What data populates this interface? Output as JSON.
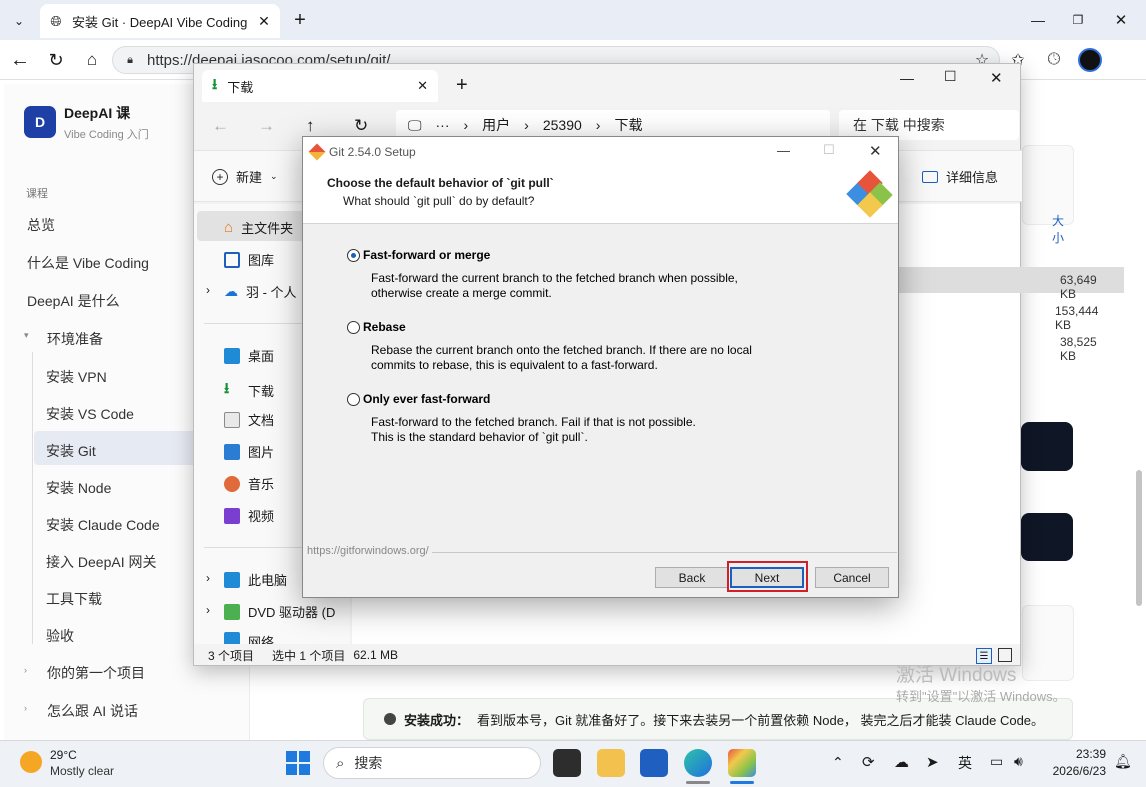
{
  "browser": {
    "tab_title": "安装 Git · DeepAI Vibe Coding 课",
    "url": "https://deepai.iasocoo.com/setup/git/"
  },
  "site": {
    "logo_letter": "D",
    "name": "DeepAI 课",
    "subtitle": "Vibe Coding 入门",
    "section_label": "课程",
    "nav": [
      "总览",
      "什么是 Vibe Coding",
      "DeepAI 是什么"
    ],
    "env_group": "环境准备",
    "env_items": [
      "安装 VPN",
      "安装 VS Code",
      "安装 Git",
      "安装 Node",
      "安装 Claude Code",
      "接入 DeepAI 网关",
      "工具下载",
      "验收"
    ],
    "nav_bottom": [
      "你的第一个项目",
      "怎么跟 AI 说话"
    ],
    "notice_label": "安装成功：",
    "notice_text": "看到版本号，Git 就准备好了。接下来去装另一个前置依赖 Node， 装完之后才能装 Claude Code。"
  },
  "explorer": {
    "tab_title": "下载",
    "path": [
      "用户",
      "25390",
      "下载"
    ],
    "search_placeholder": "在 下载 中搜索",
    "new_label": "新建",
    "details_label": "详细信息",
    "size_col": "大小",
    "sizes": [
      "63,649 KB",
      "153,444 KB",
      "38,525 KB"
    ],
    "nav_items": [
      "主文件夹",
      "图库",
      "羽 - 个人"
    ],
    "quick_items": [
      "桌面",
      "下载",
      "文档",
      "图片",
      "音乐",
      "视频"
    ],
    "drive_items": [
      "此电脑",
      "DVD 驱动器 (D",
      "网络"
    ],
    "status_count": "3 个项目",
    "status_selected": "选中 1 个项目",
    "status_size": "62.1 MB"
  },
  "dialog": {
    "title": "Git 2.54.0 Setup",
    "heading": "Choose the default behavior of `git pull`",
    "subheading": "What should `git pull` do by default?",
    "options": [
      {
        "label": "Fast-forward or merge",
        "desc1": "Fast-forward the current branch to the fetched branch when possible,",
        "desc2": "otherwise create a merge commit.",
        "selected": true
      },
      {
        "label": "Rebase",
        "desc1": "Rebase the current branch onto the fetched branch. If there are no local",
        "desc2": "commits to rebase, this is equivalent to a fast-forward.",
        "selected": false
      },
      {
        "label": "Only ever fast-forward",
        "desc1": "Fast-forward to the fetched branch. Fail if that is not possible.",
        "desc2": "This is the standard behavior of `git pull`.",
        "selected": false
      }
    ],
    "footer_link": "https://gitforwindows.org/",
    "back": "Back",
    "next": "Next",
    "cancel": "Cancel"
  },
  "watermark": {
    "line1": "激活 Windows",
    "line2": "转到\"设置\"以激活 Windows。"
  },
  "taskbar": {
    "weather_temp": "29°C",
    "weather_text": "Mostly clear",
    "search": "搜索",
    "ime": "英",
    "time": "23:39",
    "date": "2026/6/23"
  },
  "colors": {
    "accent": "#1c5fbf",
    "highlight_border": "#d0202a",
    "sidebar_active": "#e6eaf2",
    "dark_button": "#0f1626"
  }
}
